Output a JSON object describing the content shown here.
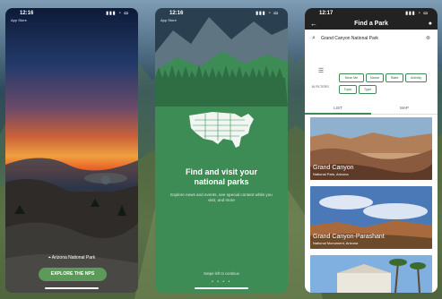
{
  "status_times": [
    "12:16",
    "12:16",
    "12:17"
  ],
  "app_store_back": [
    "App Store",
    "App Store"
  ],
  "phone1": {
    "location": "Arizona National Park",
    "button": "EXPLORE THE NPS"
  },
  "phone2": {
    "title": "Find and visit your\nnational parks",
    "description": "Explore news and events, see special content while you visit, and more",
    "skip": "Swipe left to continue",
    "page_dots": "• • • •"
  },
  "phone3": {
    "header": "Find a Park",
    "search_value": "Grand Canyon National Park",
    "filters_label": "16 FILTERS",
    "chips": [
      "Near Me",
      "Name",
      "State",
      "Activity",
      "Topic",
      "Type"
    ],
    "tabs": [
      "LIST",
      "MAP"
    ],
    "cards": [
      {
        "name": "Grand Canyon",
        "subtitle": "National Park, Arizona"
      },
      {
        "name": "Grand Canyon-Parashant",
        "subtitle": "National Monument, Arizona"
      }
    ]
  },
  "icons": {
    "signal": "signal-icon",
    "wifi": "wifi-icon",
    "battery": "battery-icon",
    "back": "back-arrow-icon",
    "user": "user-icon",
    "search": "search-icon",
    "clear": "clear-icon",
    "filter": "filter-icon",
    "location": "location-pin-icon"
  }
}
